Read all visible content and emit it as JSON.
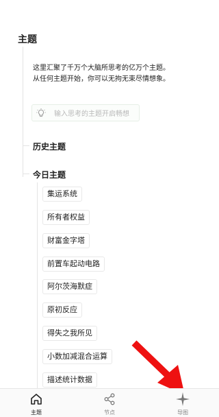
{
  "page": {
    "title": "主题",
    "intro_line1": "这里汇聚了千万个大脑所思考的亿万个主题。",
    "intro_line2": "从任何主题开始，你可以无拘无束尽情想象。"
  },
  "search": {
    "placeholder": "输入思考的主题开启畅想",
    "icon": "lightbulb-icon"
  },
  "sections": {
    "history_title": "历史主题",
    "today_title": "今日主题"
  },
  "today_topics": [
    "集运系统",
    "所有者权益",
    "财富金字塔",
    "前置车起动电路",
    "阿尔茨海默症",
    "原初反应",
    "得失之我所见",
    "小数加减混合运算",
    "描述统计数据"
  ],
  "bottom_nav": {
    "items": [
      {
        "label": "主题",
        "icon": "home-icon",
        "active": true
      },
      {
        "label": "节点",
        "icon": "share-nodes-icon",
        "active": false
      },
      {
        "label": "导图",
        "icon": "sparkle-star-icon",
        "active": false
      }
    ]
  },
  "colors": {
    "annotation_arrow": "#ee1111",
    "tree_line": "#e3e3e3",
    "input_border": "#e6efe6"
  }
}
